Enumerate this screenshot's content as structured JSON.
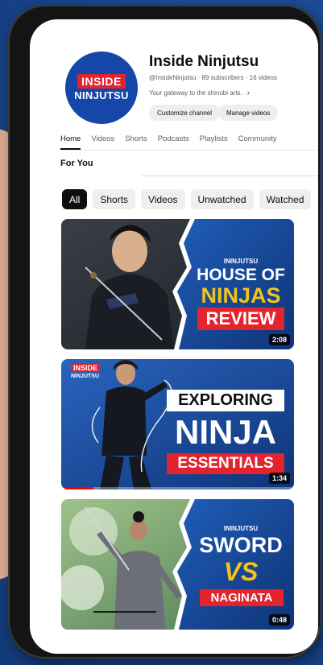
{
  "channel": {
    "avatar_line1": "INSIDE",
    "avatar_line2": "NINJUTSU",
    "name": "Inside Ninjutsu",
    "meta": "@InsideNinjutsu · 89 subscribers · 16 videos",
    "description": "Your gateway to the shinobi arts.",
    "customize_label": "Customize channel",
    "manage_label": "Manage videos"
  },
  "tabs": [
    "Home",
    "Videos",
    "Shorts",
    "Podcasts",
    "Playlists",
    "Community"
  ],
  "section_title": "For You",
  "chips": [
    "All",
    "Shorts",
    "Videos",
    "Unwatched",
    "Watched"
  ],
  "videos": [
    {
      "brand": "ININJUTSU",
      "line1": "HOUSE OF",
      "line2": "NINJAS",
      "line3": "REVIEW",
      "duration": "2:08",
      "watched_fraction": 0
    },
    {
      "brand_top": "INSIDE",
      "brand_bottom": "NINJUTSU",
      "line1": "EXPLORING",
      "line2": "NINJA",
      "line3": "ESSENTIALS",
      "duration": "1:34",
      "watched_fraction": 0.14
    },
    {
      "brand": "ININJUTSU",
      "line1": "SWORD",
      "line2": "VS",
      "line3": "NAGINATA",
      "duration": "0:48",
      "watched_fraction": 0
    }
  ],
  "colors": {
    "brand_blue": "#1447a8",
    "brand_red": "#e3232e",
    "accent_yellow": "#f4c21a",
    "progress_red": "#ff0000"
  }
}
